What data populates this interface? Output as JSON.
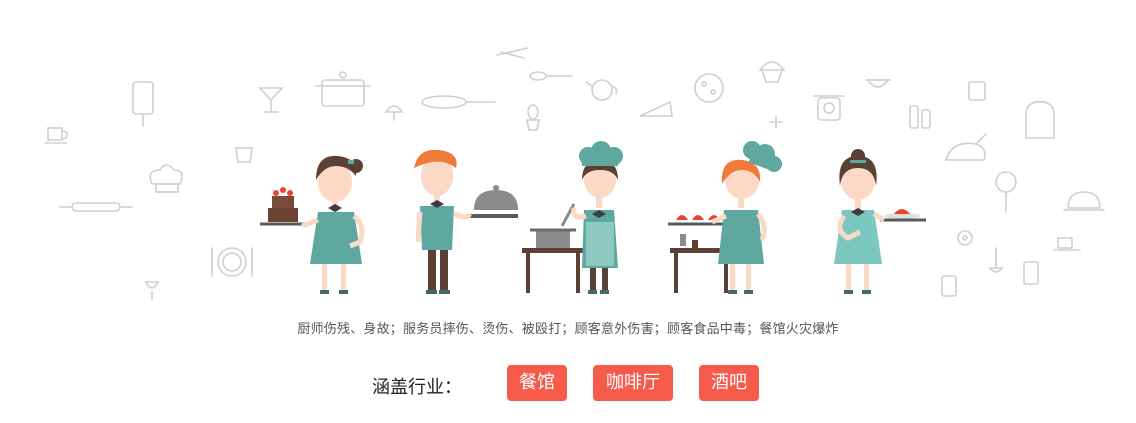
{
  "caption": "厨师伤残、身故；服务员摔伤、烫伤、被殴打；顾客意外伤害；顾客食品中毒；餐馆火灾爆炸",
  "industry": {
    "label": "涵盖行业：",
    "tags": [
      "餐馆",
      "咖啡厅",
      "酒吧"
    ]
  },
  "colors": {
    "tag_bg": "#f65a4a",
    "teal": "#5fa8a0",
    "hair_dark": "#5a4035",
    "hair_orange": "#f07a3a",
    "skin": "#fbd9c4",
    "line_icons": "#cfcfcf"
  },
  "illustration": {
    "characters": [
      "waitress-with-cake",
      "waiter-with-cloche",
      "chef-cooking-at-table",
      "chef-with-dishes",
      "waitress-with-plate"
    ],
    "background_icons": [
      "coffee-cup-icon",
      "rolling-pin-icon",
      "cutting-board-icon",
      "cocktail-icon",
      "pot-icon",
      "mushroom-icon",
      "frying-pan-icon",
      "knives-icon",
      "whisk-icon",
      "teapot-icon",
      "cake-slice-icon",
      "pizza-icon",
      "cupcake-icon",
      "scale-icon",
      "kettle-icon",
      "chicken-icon",
      "magnifier-icon",
      "cloche-icon",
      "wine-glass-icon",
      "plate-icon",
      "ladle-icon",
      "chef-hat-icon"
    ]
  }
}
